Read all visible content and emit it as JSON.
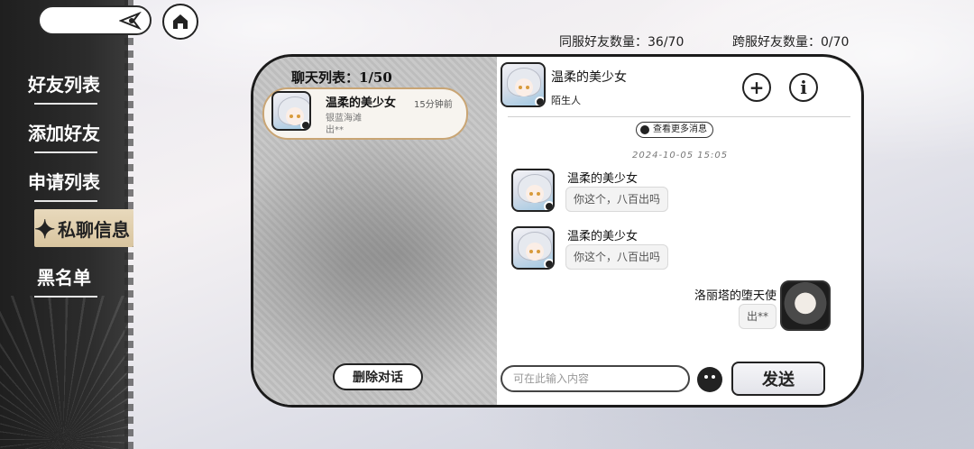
{
  "sidebar": {
    "items": [
      {
        "label": "好友列表"
      },
      {
        "label": "添加好友"
      },
      {
        "label": "申请列表"
      },
      {
        "label": "私聊信息"
      },
      {
        "label": "黑名单"
      }
    ],
    "active_index": 3
  },
  "counts": {
    "same_server": "同服好友数量：36/70",
    "cross_server": "跨服好友数量：0/70"
  },
  "chat_list": {
    "title": "聊天列表：1/50",
    "items": [
      {
        "name": "温柔的美少女",
        "time": "15分钟前",
        "location": "银蓝海滩",
        "preview": "出**"
      }
    ],
    "delete_label": "删除对话"
  },
  "conversation": {
    "partner_name": "温柔的美少女",
    "partner_status": "陌生人",
    "more_messages_label": "查看更多消息",
    "timestamp": "2024-10-05 15:05",
    "messages": [
      {
        "sender": "温柔的美少女",
        "text": "你这个，八百出吗"
      },
      {
        "sender": "温柔的美少女",
        "text": "你这个，八百出吗"
      },
      {
        "sender": "洛丽塔的堕天使",
        "text": "出**"
      }
    ],
    "input_placeholder": "可在此输入内容",
    "send_label": "发送"
  },
  "icons": {
    "search": "search-icon",
    "home": "home-icon",
    "add": "plus-icon",
    "info": "info-icon",
    "emoji": "emoji-icon",
    "clock": "clock-icon"
  },
  "colors": {
    "card_border": "#c9a574",
    "active_nav": "#d9c59f",
    "sidebar": "#2c2c2c"
  }
}
